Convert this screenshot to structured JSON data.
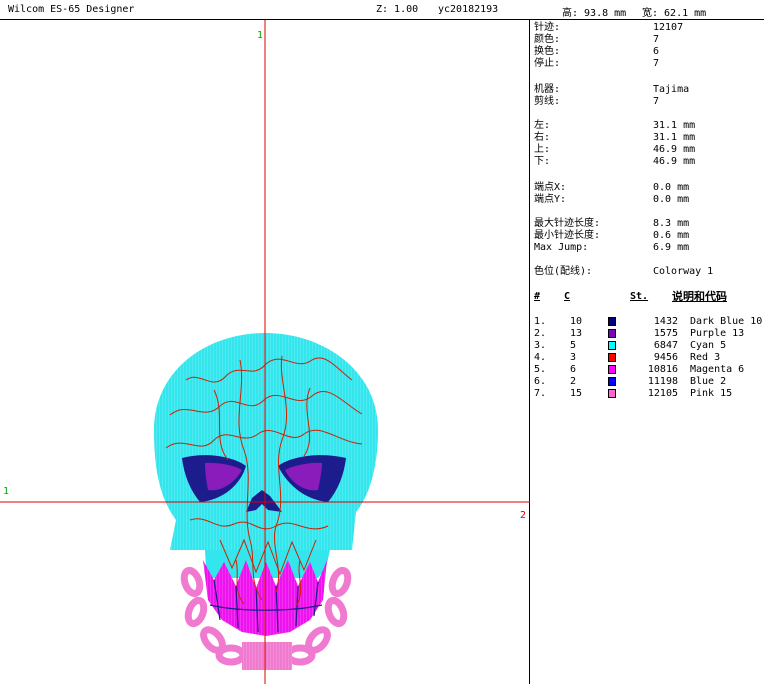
{
  "titlebar": {
    "app_title": "Wilcom ES-65 Designer",
    "zoom": "Z: 1.00",
    "file_name": "yc20182193",
    "height": "高: 93.8 mm",
    "width": "宽: 62.1 mm"
  },
  "canvas": {
    "axis_top_marker": "1",
    "axis_left_marker": "1",
    "axis_right_marker": "2",
    "colors": {
      "cyan": "#33e6ee",
      "dark_blue": "#1c1c8c",
      "purple": "#8a1cbb",
      "magenta": "#ee12ee",
      "pink": "#f07ad0",
      "red_lines": "#cc2200",
      "crosshair": "#dd0000"
    }
  },
  "info": {
    "stitches": {
      "label": "针迹:",
      "value": "12107"
    },
    "colors": {
      "label": "颜色:",
      "value": "7"
    },
    "color_changes": {
      "label": "换色:",
      "value": "6"
    },
    "stops": {
      "label": "停止:",
      "value": "7"
    },
    "machine": {
      "label": "机器:",
      "value": "Tajima"
    },
    "trims": {
      "label": "剪线:",
      "value": "7"
    },
    "left": {
      "label": "左:",
      "value": "31.1 mm"
    },
    "right": {
      "label": "右:",
      "value": "31.1 mm"
    },
    "up": {
      "label": "上:",
      "value": "46.9 mm"
    },
    "down": {
      "label": "下:",
      "value": "46.9 mm"
    },
    "end_x": {
      "label": "端点X:",
      "value": "0.0 mm"
    },
    "end_y": {
      "label": "端点Y:",
      "value": "0.0 mm"
    },
    "max_stitch": {
      "label": "最大针迹长度:",
      "value": "8.3 mm"
    },
    "min_stitch": {
      "label": "最小针迹长度:",
      "value": "0.6 mm"
    },
    "max_jump": {
      "label": "Max Jump:",
      "value": "6.9 mm"
    },
    "colorway": {
      "label": "色位(配线):",
      "value": "Colorway 1"
    }
  },
  "color_table": {
    "headers": {
      "num": "#",
      "code": "C",
      "stitches": "St.",
      "desc": "说明和代码"
    },
    "rows": [
      {
        "num": "1.",
        "code": "10",
        "color": "#000080",
        "stitches": "1432",
        "desc": "Dark Blue 10"
      },
      {
        "num": "2.",
        "code": "13",
        "color": "#8000c0",
        "stitches": "1575",
        "desc": "Purple 13"
      },
      {
        "num": "3.",
        "code": "5",
        "color": "#00ffff",
        "stitches": "6847",
        "desc": "Cyan 5"
      },
      {
        "num": "4.",
        "code": "3",
        "color": "#ff0000",
        "stitches": "9456",
        "desc": "Red 3"
      },
      {
        "num": "5.",
        "code": "6",
        "color": "#ff00ff",
        "stitches": "10816",
        "desc": "Magenta 6"
      },
      {
        "num": "6.",
        "code": "2",
        "color": "#0000ff",
        "stitches": "11198",
        "desc": "Blue 2"
      },
      {
        "num": "7.",
        "code": "15",
        "color": "#ff66cc",
        "stitches": "12105",
        "desc": "Pink 15"
      }
    ]
  }
}
